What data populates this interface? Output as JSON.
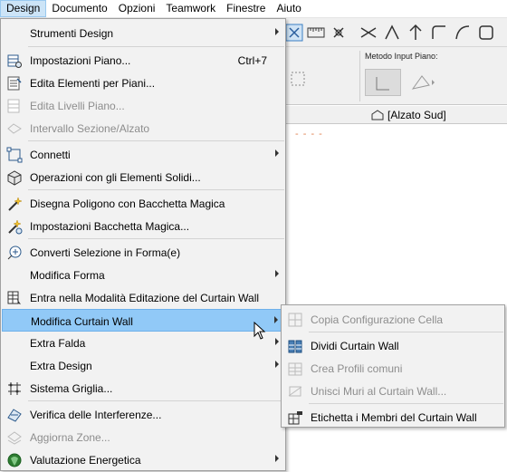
{
  "menubar": {
    "items": [
      {
        "label": "Design",
        "active": true
      },
      {
        "label": "Documento"
      },
      {
        "label": "Opzioni"
      },
      {
        "label": "Teamwork"
      },
      {
        "label": "Finestre"
      },
      {
        "label": "Aiuto"
      }
    ]
  },
  "background": {
    "infobox_label": "Metodo Input Piano:",
    "tab_label": "[Alzato Sud]",
    "dashes": "- - - -"
  },
  "menu": {
    "items": [
      {
        "label": "Strumenti Design",
        "icon": "none",
        "submenu": true
      },
      {
        "label": "Impostazioni Piano...",
        "icon": "story-settings-icon",
        "shortcut": "Ctrl+7"
      },
      {
        "label": "Edita Elementi per Piani...",
        "icon": "edit-elements-by-story-icon"
      },
      {
        "label": "Edita Livelli Piano...",
        "icon": "edit-story-levels-icon",
        "disabled": true
      },
      {
        "label": "Intervallo Sezione/Alzato",
        "icon": "section-range-icon",
        "disabled": true
      },
      {
        "label": "Connetti",
        "icon": "connect-icon",
        "submenu": true
      },
      {
        "label": "Operazioni con gli Elementi Solidi...",
        "icon": "solid-operations-icon"
      },
      {
        "label": "Disegna Poligono con Bacchetta Magica",
        "icon": "magic-wand-polygon-icon"
      },
      {
        "label": "Impostazioni Bacchetta Magica...",
        "icon": "magic-wand-settings-icon"
      },
      {
        "label": "Converti Selezione in Forma(e)",
        "icon": "convert-to-morph-icon"
      },
      {
        "label": "Modifica Forma",
        "icon": "none",
        "submenu": true
      },
      {
        "label": "Entra nella Modalità Editazione del Curtain Wall",
        "icon": "curtain-wall-edit-mode-icon"
      },
      {
        "label": "Modifica Curtain Wall",
        "icon": "none",
        "submenu": true,
        "highlighted": true
      },
      {
        "label": "Extra Falda",
        "icon": "none",
        "submenu": true
      },
      {
        "label": "Extra Design",
        "icon": "none",
        "submenu": true
      },
      {
        "label": "Sistema Griglia...",
        "icon": "grid-system-icon"
      },
      {
        "label": "Verifica delle Interferenze...",
        "icon": "collision-detection-icon"
      },
      {
        "label": "Aggiorna Zone...",
        "icon": "update-zones-icon",
        "disabled": true
      },
      {
        "label": "Valutazione Energetica",
        "icon": "energy-evaluation-icon",
        "submenu": true
      }
    ]
  },
  "submenu": {
    "items": [
      {
        "label": "Copia Configurazione Cella",
        "icon": "copy-cell-config-icon",
        "disabled": true
      },
      {
        "label": "Dividi Curtain Wall",
        "icon": "split-curtain-wall-icon"
      },
      {
        "label": "Crea Profili comuni",
        "icon": "create-common-frames-icon",
        "disabled": true
      },
      {
        "label": "Unisci Muri al Curtain Wall...",
        "icon": "merge-walls-icon",
        "disabled": true
      },
      {
        "label": "Etichetta i Membri del Curtain Wall",
        "icon": "label-members-icon"
      }
    ]
  },
  "colors": {
    "highlight": "#91c9f7",
    "menubar_active": "#cce4f7",
    "disabled_text": "#8d8d8d"
  }
}
